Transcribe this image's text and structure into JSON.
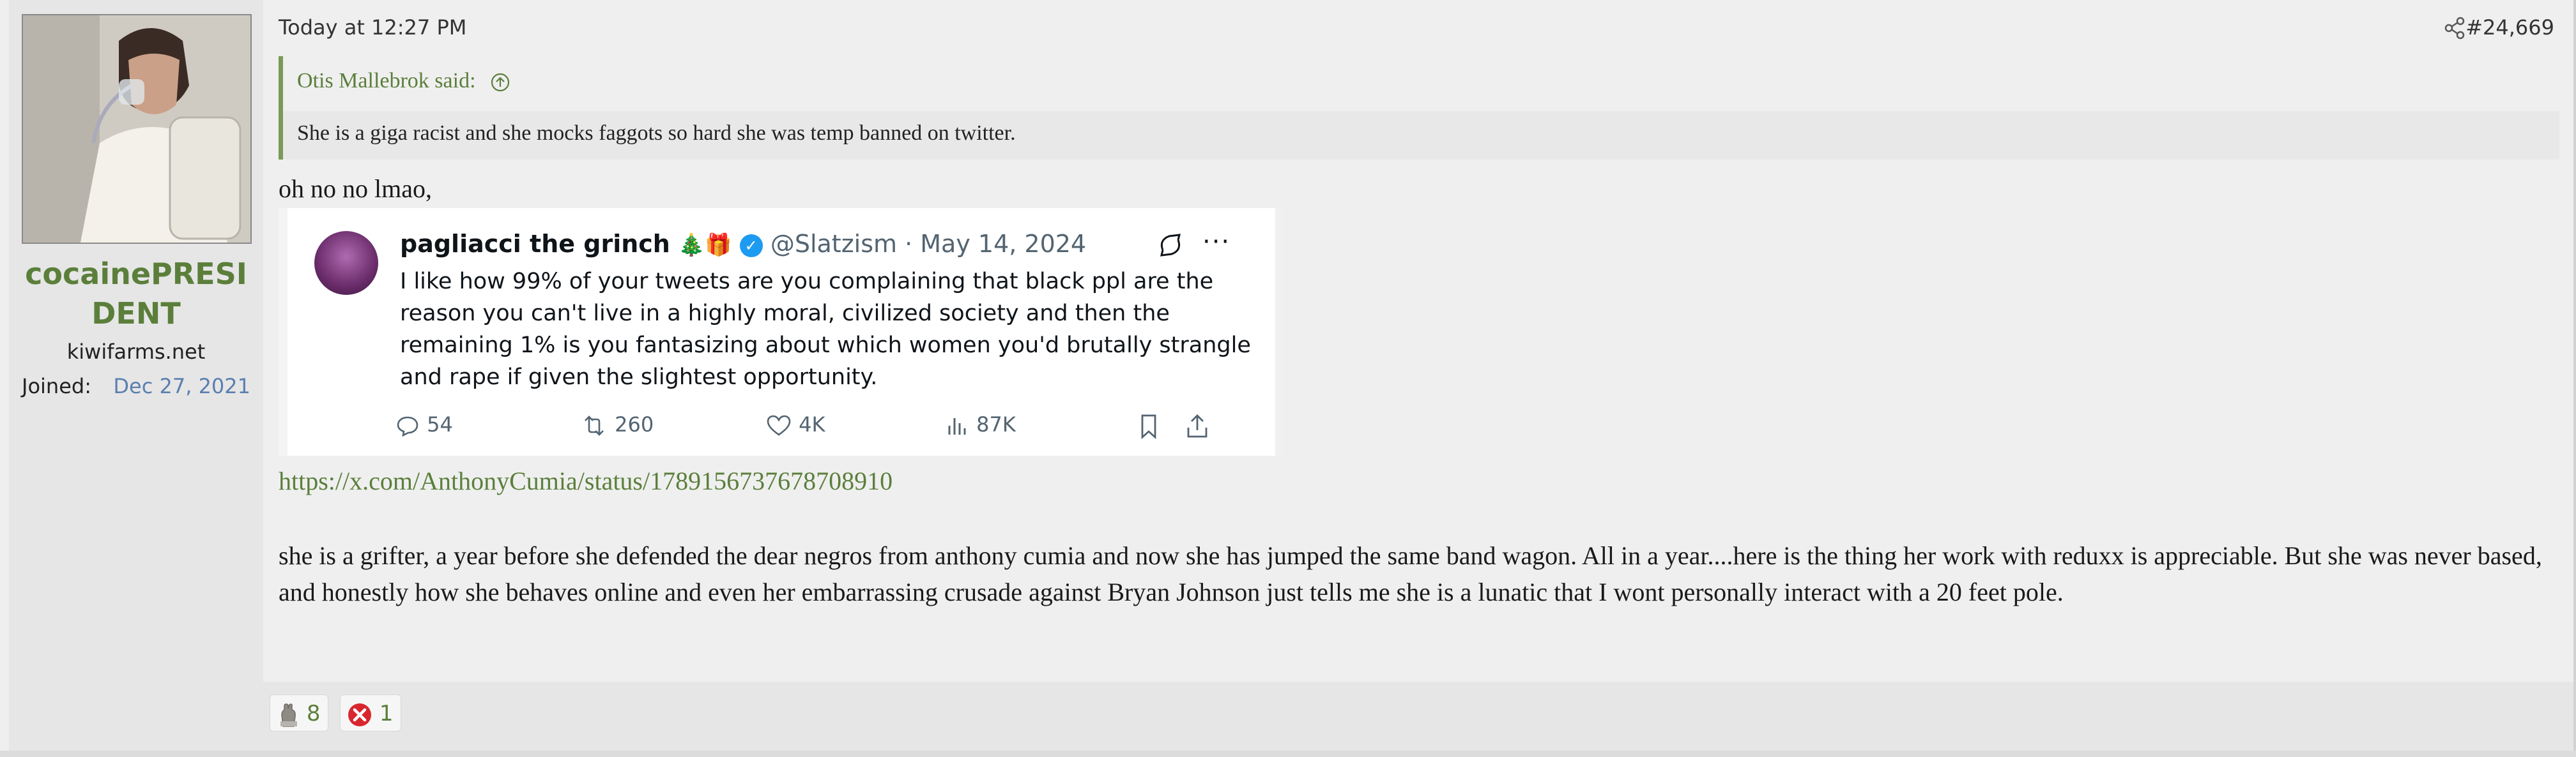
{
  "user": {
    "name": "cocainePRESIDENT",
    "site": "kiwifarms.net",
    "joined_label": "Joined:",
    "joined_date": "Dec 27, 2021"
  },
  "post": {
    "time": "Today at 12:27 PM",
    "number": "#24,669"
  },
  "quote": {
    "author": "Otis Mallebrok said:",
    "text": "She is a giga racist and she mocks faggots so hard she was temp banned on twitter."
  },
  "message": {
    "line1": "oh no no lmao,",
    "link": "https://x.com/AnthonyCumia/status/1789156737678708910",
    "body": "she is a grifter, a year before she defended the dear negros from anthony cumia and now she has jumped the same band wagon. All in a year....here is the thing her work with reduxx is appreciable. But she was never based, and honestly how she behaves online and even her embarrassing crusade against Bryan Johnson just tells me she is a lunatic that I wont personally interact with a 20 feet pole."
  },
  "tweet": {
    "name": "pagliacci the grinch",
    "emoji": "🎄🎁",
    "handle": "@Slatzism · May 14, 2024",
    "text": "I like how 99% of your tweets are you complaining that black ppl are the reason you can't live in a highly moral, civilized society and then the remaining 1% is you fantasizing about which women you'd brutally strangle and rape if given the slightest opportunity.",
    "replies": "54",
    "retweets": "260",
    "likes": "4K",
    "views": "87K",
    "more": "···",
    "verified_mark": "✓"
  },
  "reactions": [
    {
      "count": "8"
    },
    {
      "count": "1"
    }
  ],
  "colors": {
    "accent": "#5b7f3b",
    "date_link": "#5b7fb0",
    "twitter_blue": "#1d9bf0",
    "negative": "#d9262e"
  }
}
